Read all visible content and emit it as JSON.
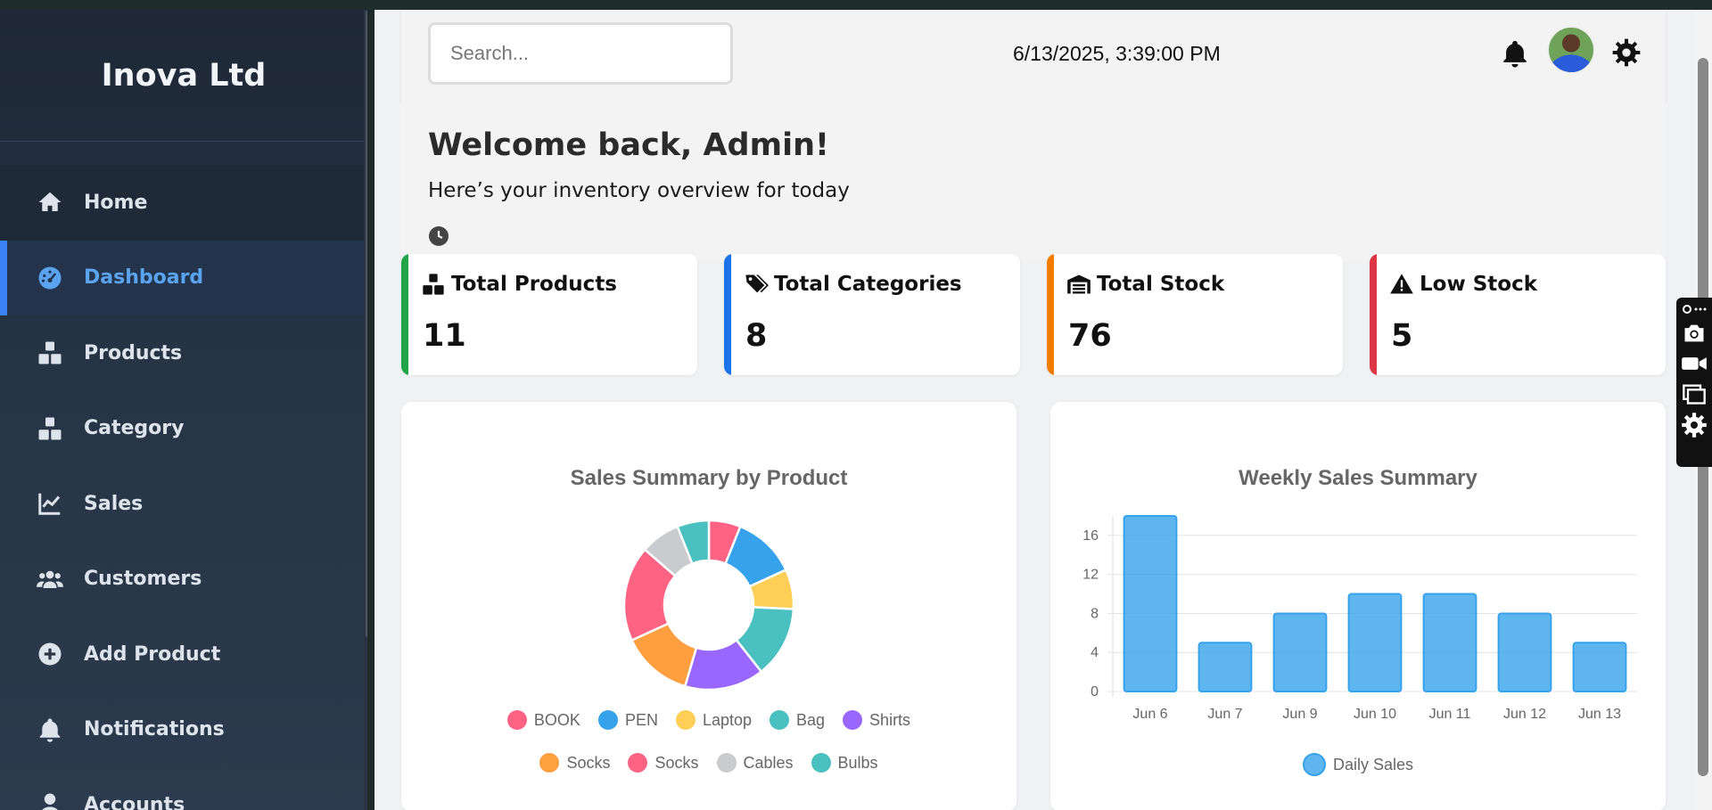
{
  "brand": "Inova Ltd",
  "sidebar": {
    "items": [
      {
        "label": "Home"
      },
      {
        "label": "Dashboard"
      },
      {
        "label": "Products"
      },
      {
        "label": "Category"
      },
      {
        "label": "Sales"
      },
      {
        "label": "Customers"
      },
      {
        "label": "Add Product"
      },
      {
        "label": "Notifications"
      },
      {
        "label": "Accounts"
      }
    ]
  },
  "topbar": {
    "search_placeholder": "Search...",
    "datetime": "6/13/2025, 3:39:00 PM"
  },
  "welcome": {
    "title": "Welcome back, Admin!",
    "subtitle": "Here’s your inventory overview for today"
  },
  "stats": [
    {
      "label": "Total Products",
      "value": "11",
      "color": "#22a447"
    },
    {
      "label": "Total Categories",
      "value": "8",
      "color": "#1a73e8"
    },
    {
      "label": "Total Stock",
      "value": "76",
      "color": "#f57c00"
    },
    {
      "label": "Low Stock",
      "value": "5",
      "color": "#dc3545"
    }
  ],
  "chart_data": [
    {
      "type": "pie",
      "title": "Sales Summary by Product",
      "categories": [
        "BOOK",
        "PEN",
        "Laptop",
        "Bag",
        "Shirts",
        "Socks",
        "Socks",
        "Cables",
        "Bulbs"
      ],
      "values": [
        4,
        8,
        5,
        9,
        10,
        9,
        12,
        5,
        4
      ],
      "colors": [
        "#ff6384",
        "#36a2eb",
        "#ffce56",
        "#4bc0c0",
        "#9966ff",
        "#ff9f40",
        "#ff6384",
        "#c9cbcf",
        "#4bc0c0"
      ],
      "legend": "bottom"
    },
    {
      "type": "bar",
      "title": "Weekly Sales Summary",
      "categories": [
        "Jun 6",
        "Jun 7",
        "Jun 9",
        "Jun 10",
        "Jun 11",
        "Jun 12",
        "Jun 13"
      ],
      "series": [
        {
          "name": "Daily Sales",
          "values": [
            18,
            5,
            8,
            10,
            10,
            8,
            5
          ]
        }
      ],
      "ylim": [
        0,
        18
      ],
      "yticks": [
        0,
        4,
        8,
        12,
        16
      ],
      "grid": true,
      "legend": "bottom"
    }
  ]
}
